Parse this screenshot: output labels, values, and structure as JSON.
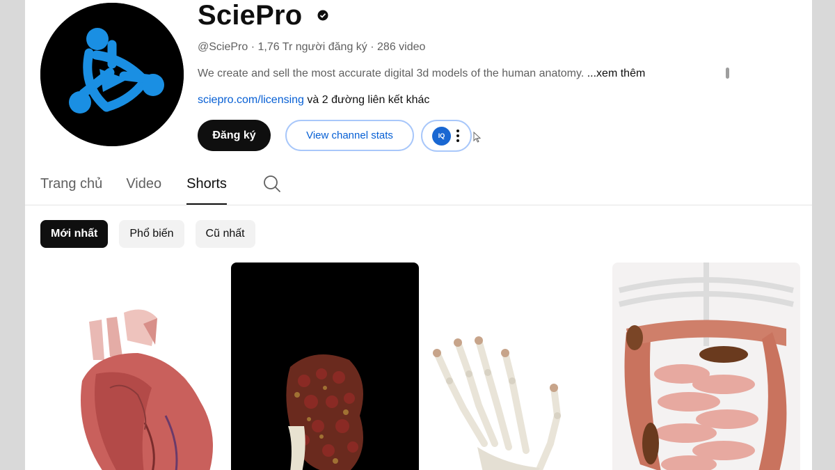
{
  "channel": {
    "name": "SciePro",
    "handle": "@SciePro",
    "subscribers": "1,76 Tr người đăng ký",
    "videos": "286 video",
    "description": "We create and sell the most accurate digital 3d models of the human anatomy. ",
    "more_label": "...xem thêm",
    "link": "sciepro.com/licensing",
    "other_links": " và 2 đường liên kết khác"
  },
  "actions": {
    "subscribe_label": "Đăng ký",
    "stats_label": "View channel stats",
    "extension_logo": "IQ"
  },
  "tabs": [
    {
      "label": "Trang chủ"
    },
    {
      "label": "Video"
    },
    {
      "label": "Shorts",
      "active": true
    }
  ],
  "chips": [
    {
      "label": "Mới nhất",
      "selected": true
    },
    {
      "label": "Phổ biến"
    },
    {
      "label": "Cũ nhất"
    }
  ],
  "shorts": [
    {
      "subject": "heart",
      "icon": "heart-thumbnail"
    },
    {
      "subject": "kidney",
      "icon": "kidney-thumbnail"
    },
    {
      "subject": "hand-skeleton",
      "icon": "hand-thumbnail"
    },
    {
      "subject": "intestines",
      "icon": "intestines-thumbnail"
    }
  ],
  "colors": {
    "brand_blue": "#1a8fe3",
    "link": "#065fd4",
    "chip_selected": "#0f0f0f"
  }
}
